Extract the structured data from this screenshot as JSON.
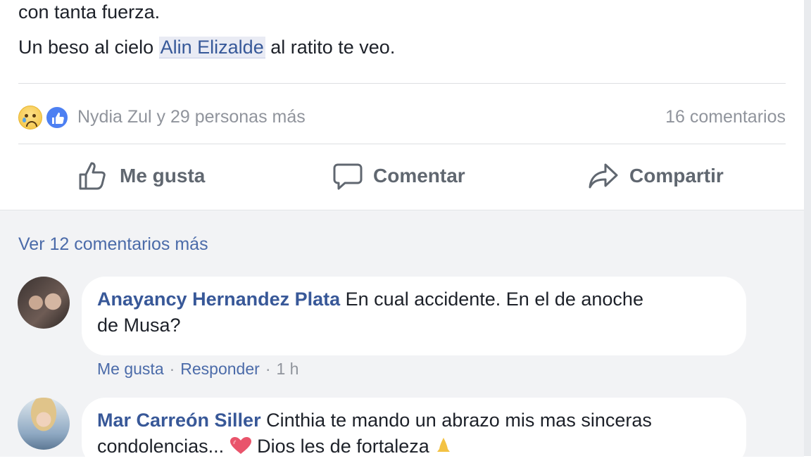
{
  "post": {
    "text_line1": "con tanta fuerza.",
    "text_line2_pre": "Un beso al cielo",
    "mention": "Alin Elizalde",
    "text_line2_post": "al ratito te veo."
  },
  "reactions": {
    "icons": [
      "sad-face-icon",
      "like-thumb-icon"
    ],
    "summary": "Nydia Zul y 29 personas más",
    "comments_count": "16 comentarios"
  },
  "actions": {
    "like": "Me gusta",
    "comment": "Comentar",
    "share": "Compartir"
  },
  "comments_section": {
    "view_more": "Ver 12 comentarios más",
    "comments": [
      {
        "author": "Anayancy Hernandez Plata",
        "text_line1": "En cual accidente. En el de anoche",
        "text_line2": "de Musa?",
        "like": "Me gusta",
        "reply": "Responder",
        "time": "1 h"
      },
      {
        "author": "Mar Carreón Siller",
        "text_line1": "Cinthia te mando un abrazo mis mas sinceras",
        "text_line2_pre": "condolencias...",
        "text_line2_mid": "Dios les de fortaleza"
      }
    ]
  },
  "colors": {
    "link": "#385898",
    "meta": "#90949c",
    "like_badge": "#4d80f2",
    "comments_bg": "#f2f3f5"
  }
}
